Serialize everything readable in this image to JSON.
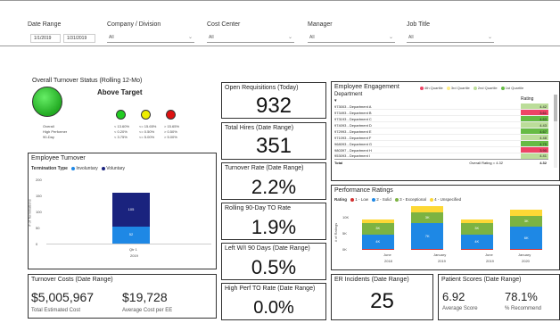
{
  "filters": {
    "date_range_label": "Date Range",
    "date_start": "1/1/2019",
    "date_end": "1/31/2019",
    "company_label": "Company / Division",
    "company_value": "All",
    "cost_center_label": "Cost Center",
    "cost_center_value": "All",
    "manager_label": "Manager",
    "manager_value": "All",
    "job_title_label": "Job Title",
    "job_title_value": "All"
  },
  "turnover_status": {
    "title": "Overall Turnover Status (Rolling 12-Mo)",
    "status": "Above Target",
    "status_color": "#22aa22",
    "legend_colors": [
      "#22cc22",
      "#eeee00",
      "#dd1111"
    ],
    "rows": [
      {
        "label": "Overall",
        "vals": [
          "< 13.60%",
          "<= 15.65%",
          "> 15.65%"
        ]
      },
      {
        "label": "High Performer",
        "vals": [
          "< 0.20%",
          "<= 0.50%",
          "> 0.50%"
        ]
      },
      {
        "label": "90-Day",
        "vals": [
          "< 3.75%",
          "<= 5.00%",
          "> 5.00%"
        ]
      }
    ]
  },
  "kpis": {
    "open_req_title": "Open Requisitions (Today)",
    "open_req_value": "932",
    "total_hires_title": "Total Hires (Date Range)",
    "total_hires_value": "351",
    "turnover_rate_title": "Turnover Rate (Date Range)",
    "turnover_rate_value": "2.2%",
    "rolling_title": "Rolling 90-Day TO Rate",
    "rolling_value": "1.9%",
    "left90_title": "Left W/I 90 Days (Date Range)",
    "left90_value": "0.5%",
    "highperf_title": "High Perf TO Rate (Date Range)",
    "highperf_value": "0.0%"
  },
  "employee_turnover": {
    "title": "Employee Turnover",
    "legend_title": "Termination Type",
    "legend": [
      {
        "name": "Involuntary",
        "color": "#1e88e5"
      },
      {
        "name": "Voluntary",
        "color": "#1a237e"
      }
    ],
    "ylabel": "# of Terminations",
    "yticks": [
      "200",
      "150",
      "100",
      "50",
      "0"
    ],
    "ymax": 200,
    "category": "Qtr 1",
    "year": "2019",
    "involuntary": 52,
    "voluntary": 105
  },
  "turnover_costs": {
    "title": "Turnover Costs (Date Range)",
    "total_value": "$5,005,967",
    "total_label": "Total Estimated Cost",
    "avg_value": "$19,728",
    "avg_label": "Average Cost per EE"
  },
  "engagement": {
    "title": "Employee Engagement",
    "col_dept": "Department",
    "col_rating": "Rating",
    "legend": [
      {
        "name": "4th Quartile",
        "color": "#ee4466"
      },
      {
        "name": "3rd Quartile",
        "color": "#ffee88"
      },
      {
        "name": "2nd Quartile",
        "color": "#bbdd99"
      },
      {
        "name": "1st Quartile",
        "color": "#66bb44"
      }
    ],
    "rows": [
      {
        "dept": "973003 - Department A",
        "rating": "4.42",
        "color": "#bbdd99"
      },
      {
        "dept": "973493 - Department B",
        "rating": "3.61",
        "color": "#ee4466"
      },
      {
        "dept": "973193 - Department C",
        "rating": "4.63",
        "color": "#66bb44"
      },
      {
        "dept": "974093 - Department D",
        "rating": "4.43",
        "color": "#bbdd99"
      },
      {
        "dept": "972993 - Department E",
        "rating": "4.67",
        "color": "#66bb44"
      },
      {
        "dept": "971093 - Department F",
        "rating": "4.48",
        "color": "#bbdd99"
      },
      {
        "dept": "968093 - Department G",
        "rating": "4.75",
        "color": "#66bb44"
      },
      {
        "dept": "980397 - Department H",
        "rating": "3.90",
        "color": "#ee4466"
      },
      {
        "dept": "953093 - Department I",
        "rating": "4.41",
        "color": "#bbdd99"
      }
    ],
    "total_label": "Total",
    "overall_label": "Overall Rating = 4.32",
    "total_rating": "4.32"
  },
  "performance": {
    "title": "Performance Ratings",
    "legend_title": "Rating",
    "legend": [
      {
        "name": "1 - Low",
        "color": "#d32f2f"
      },
      {
        "name": "2 - Solid",
        "color": "#1e88e5"
      },
      {
        "name": "3 - Exceptional",
        "color": "#7cb342"
      },
      {
        "name": "4 - Unspecified",
        "color": "#fdd835"
      }
    ],
    "ylabel": "# of Ratings",
    "yticks": [
      "10K",
      "5K",
      "0K"
    ],
    "ymax": 12000,
    "chart_data": {
      "type": "bar",
      "categories": [
        "June 2018",
        "January 2019",
        "June 2019",
        "January 2020"
      ],
      "cat_top": [
        "June",
        "January",
        "June",
        "January"
      ],
      "cat_bottom": [
        "2018",
        "2019",
        "2019",
        "2020"
      ],
      "series": [
        {
          "name": "1 - Low",
          "values": [
            200,
            200,
            200,
            200
          ]
        },
        {
          "name": "2 - Solid",
          "values": [
            4000,
            7000,
            4000,
            6000
          ]
        },
        {
          "name": "3 - Exceptional",
          "values": [
            3000,
            3000,
            3000,
            3000
          ]
        },
        {
          "name": "4 - Unspecified",
          "values": [
            1000,
            1500,
            1000,
            1500
          ]
        }
      ],
      "labels": [
        [
          "4K",
          "3K"
        ],
        [
          "7K",
          "3K"
        ],
        [
          "4K",
          "3K"
        ],
        [
          "6K",
          "3K"
        ]
      ]
    }
  },
  "er_incidents": {
    "title": "ER Incidents (Date Range)",
    "value": "25"
  },
  "patient_scores": {
    "title": "Patient Scores (Date Range)",
    "avg_value": "6.92",
    "avg_label": "Average Score",
    "rec_value": "78.1%",
    "rec_label": "% Recommend"
  }
}
